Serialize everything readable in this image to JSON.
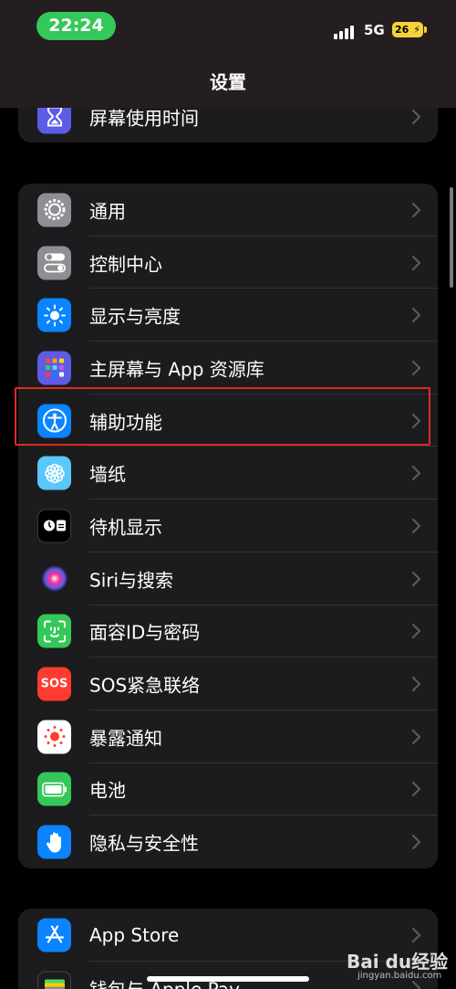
{
  "status_bar": {
    "time": "22:24",
    "network": "5G",
    "battery": "26"
  },
  "nav": {
    "title": "设置"
  },
  "group0": [
    {
      "label": "屏幕使用时间",
      "icon": "hourglass-icon",
      "color": "#5e5ce6"
    }
  ],
  "group1": [
    {
      "label": "通用",
      "icon": "gear-icon",
      "color": "#8e8e93"
    },
    {
      "label": "控制中心",
      "icon": "toggle-icon",
      "color": "#8e8e93"
    },
    {
      "label": "显示与亮度",
      "icon": "sun-icon",
      "color": "#0a84ff"
    },
    {
      "label": "主屏幕与 App 资源库",
      "icon": "app-grid-icon",
      "color": "#5e5ce6"
    },
    {
      "label": "辅助功能",
      "icon": "accessibility-icon",
      "color": "#0a84ff"
    },
    {
      "label": "墙纸",
      "icon": "flower-icon",
      "color": "#5ac8fa"
    },
    {
      "label": "待机显示",
      "icon": "standby-icon",
      "color": "#000000"
    },
    {
      "label": "Siri与搜索",
      "icon": "siri-icon",
      "color": "#1c1c1e"
    },
    {
      "label": "面容ID与密码",
      "icon": "face-id-icon",
      "color": "#34c759"
    },
    {
      "label": "SOS紧急联络",
      "icon": "sos-icon",
      "color": "#ff3b30"
    },
    {
      "label": "暴露通知",
      "icon": "exposure-icon",
      "color": "#ffffff"
    },
    {
      "label": "电池",
      "icon": "battery-icon",
      "color": "#34c759"
    },
    {
      "label": "隐私与安全性",
      "icon": "hand-icon",
      "color": "#0a84ff"
    }
  ],
  "group2": [
    {
      "label": "App Store",
      "icon": "app-store-icon",
      "color": "#0a84ff"
    },
    {
      "label": "钱包与 Apple Pay",
      "icon": "wallet-icon",
      "color": "#1c1c1e"
    }
  ],
  "icon_text": {
    "sos": "SOS"
  },
  "watermark": {
    "main": "Bai du经验",
    "sub": "jingyan.baidu.com"
  }
}
